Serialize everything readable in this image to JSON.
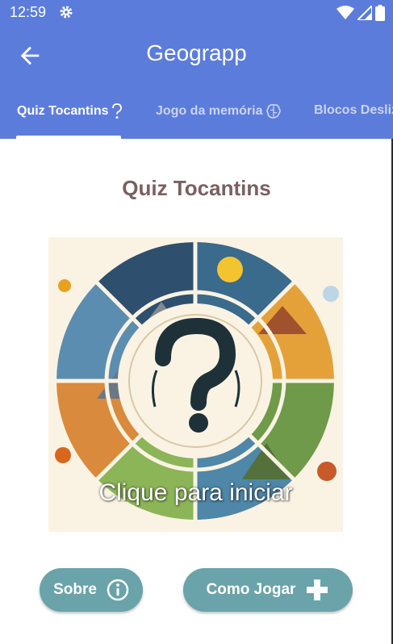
{
  "status_bar": {
    "time": "12:59",
    "icons": [
      "gear-icon",
      "wifi-icon",
      "signal-icon",
      "battery-icon"
    ]
  },
  "app_bar": {
    "title": "Geograpp",
    "back_icon": "arrow-back-icon"
  },
  "tabs": [
    {
      "label": "Quiz Tocantins",
      "icon": "question-icon",
      "active": true
    },
    {
      "label": "Jogo da memória",
      "icon": "brain-icon",
      "active": false
    },
    {
      "label": "Blocos Desliz",
      "icon": "",
      "active": false
    }
  ],
  "main": {
    "title": "Quiz Tocantins",
    "start_label": "Clique para iniciar",
    "buttons": {
      "about_label": "Sobre",
      "about_icon": "info-icon",
      "howto_label": "Como Jogar",
      "howto_icon": "gamepad-icon"
    }
  },
  "colors": {
    "app_bar": "#5c7cdc",
    "title": "#7a6060",
    "button": "#6aa3aa"
  }
}
